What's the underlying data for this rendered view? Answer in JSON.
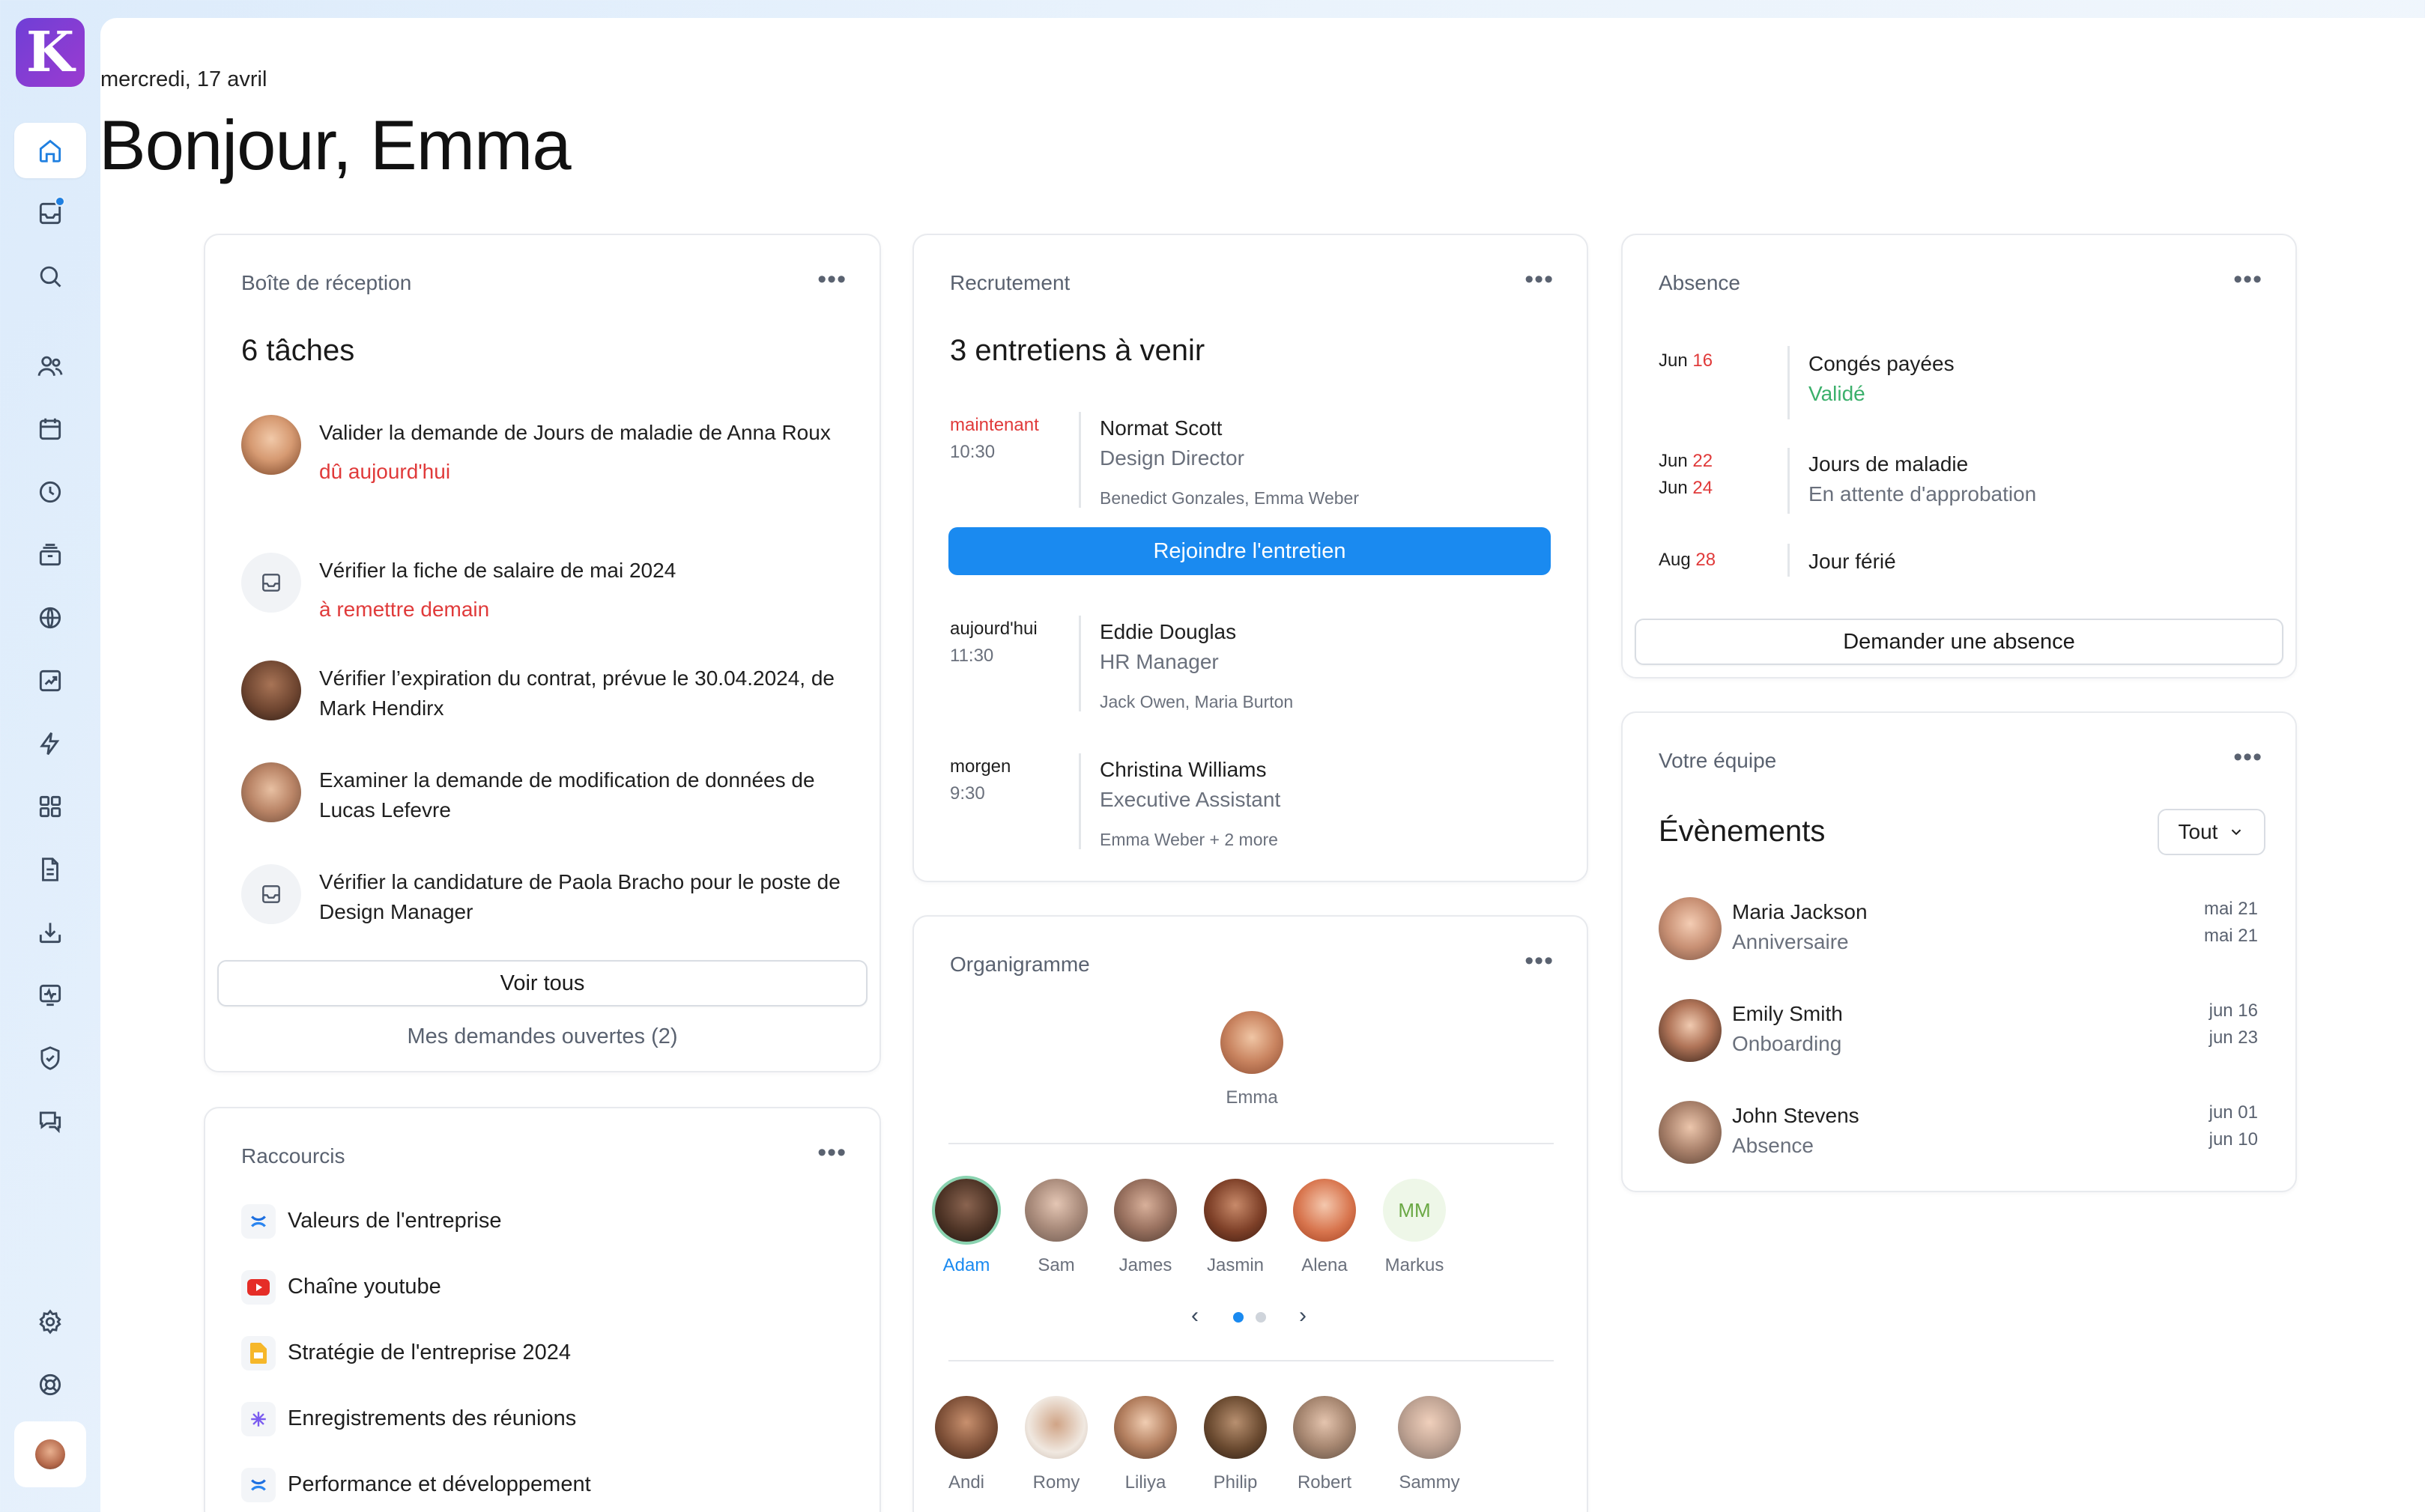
{
  "app": {
    "logo_letter": "K",
    "accent": "#1a8af0",
    "danger": "#e03a3a",
    "success": "#3bb06b"
  },
  "sidebar": {
    "items": [
      {
        "name": "home-icon"
      },
      {
        "name": "inbox-icon"
      },
      {
        "name": "search-icon"
      },
      {
        "name": "users-icon"
      },
      {
        "name": "calendar-icon"
      },
      {
        "name": "clock-icon"
      },
      {
        "name": "archive-icon"
      },
      {
        "name": "globe-icon"
      },
      {
        "name": "chart-icon"
      },
      {
        "name": "lightning-icon"
      },
      {
        "name": "apps-icon"
      },
      {
        "name": "document-icon"
      },
      {
        "name": "download-icon"
      },
      {
        "name": "health-icon"
      },
      {
        "name": "shield-icon"
      },
      {
        "name": "chat-icon"
      },
      {
        "name": "settings-icon"
      },
      {
        "name": "help-icon"
      }
    ]
  },
  "header": {
    "date": "mercredi, 17 avril",
    "greeting": "Bonjour, Emma"
  },
  "inbox": {
    "title": "Boîte de réception",
    "count": "6 tâches",
    "tasks": [
      {
        "text": "Valider la demande de Jours de maladie de Anna Roux",
        "due": "dû aujourd'hui"
      },
      {
        "text": "Vérifier la fiche de salaire de mai 2024",
        "due": "à remettre demain"
      },
      {
        "text": "Vérifier l’expiration du contrat, prévue le 30.04.2024, de Mark Hendirx",
        "due": ""
      },
      {
        "text": "Examiner la demande de modification de données de Lucas Lefevre",
        "due": ""
      },
      {
        "text": "Vérifier la candidature de Paola Bracho pour le poste de Design Manager",
        "due": ""
      }
    ],
    "see_all": "Voir tous",
    "my_requests": "Mes demandes ouvertes (2)"
  },
  "shortcuts": {
    "title": "Raccourcis",
    "items": [
      {
        "label": "Valeurs de l'entreprise"
      },
      {
        "label": "Chaîne youtube"
      },
      {
        "label": "Stratégie de l'entreprise 2024"
      },
      {
        "label": "Enregistrements des réunions"
      },
      {
        "label": "Performance et développement"
      }
    ]
  },
  "recruiting": {
    "title": "Recrutement",
    "count": "3 entretiens à venir",
    "interviews": [
      {
        "when": "maintenant",
        "time": "10:30",
        "name": "Normat Scott",
        "role": "Design Director",
        "with": "Benedict Gonzales, Emma Weber"
      },
      {
        "when": "aujourd'hui",
        "time": "11:30",
        "name": "Eddie Douglas",
        "role": "HR Manager",
        "with": "Jack Owen, Maria Burton"
      },
      {
        "when": "morgen",
        "time": "9:30",
        "name": "Christina Williams",
        "role": "Executive Assistant",
        "with": "Emma Weber + 2 more"
      }
    ],
    "join_label": "Rejoindre l'entretien"
  },
  "org": {
    "title": "Organigramme",
    "root": "Emma",
    "row1": [
      "Adam",
      "Sam",
      "James",
      "Jasmin",
      "Alena",
      "Markus"
    ],
    "markus_initials": "MM",
    "row2": [
      "Andi",
      "Romy",
      "Liliya",
      "Philip",
      "Robert",
      "Sammy"
    ]
  },
  "absence": {
    "title": "Absence",
    "items": [
      {
        "m1": "Jun",
        "d1": "16",
        "m2": "",
        "d2": "",
        "title": "Congés payées",
        "status": "Validé"
      },
      {
        "m1": "Jun",
        "d1": "22",
        "m2": "Jun",
        "d2": "24",
        "title": "Jours de maladie",
        "status": "En attente d'approbation"
      },
      {
        "m1": "Aug",
        "d1": "28",
        "m2": "",
        "d2": "",
        "title": "Jour férié",
        "status": ""
      }
    ],
    "request_label": "Demander une absence"
  },
  "team": {
    "title": "Votre équipe",
    "subtitle": "Évènements",
    "filter": "Tout",
    "events": [
      {
        "name": "Maria Jackson",
        "type": "Anniversaire",
        "d1": "mai 21",
        "d2": "mai 21"
      },
      {
        "name": "Emily Smith",
        "type": "Onboarding",
        "d1": "jun 16",
        "d2": "jun 23"
      },
      {
        "name": "John Stevens",
        "type": "Absence",
        "d1": "jun 01",
        "d2": "jun 10"
      }
    ]
  }
}
